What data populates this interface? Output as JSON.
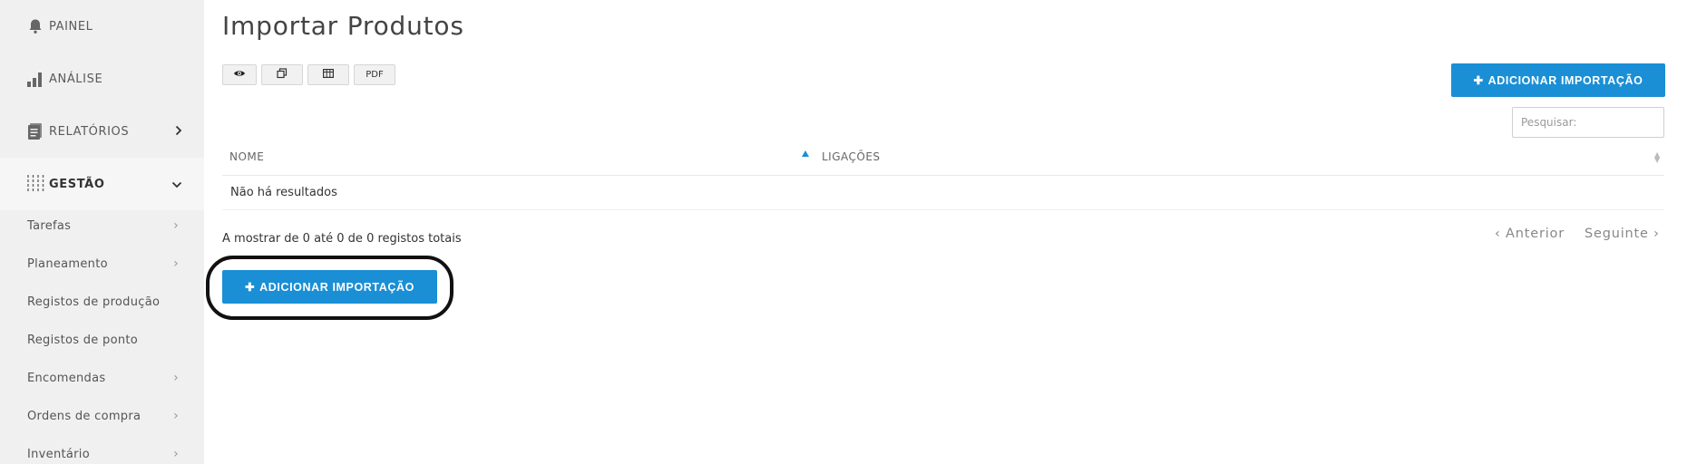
{
  "sidebar": {
    "painel": "PAINEL",
    "analise": "ANÁLISE",
    "relatorios": "RELATÓRIOS",
    "gestao": "GESTÃO",
    "sub_items": [
      {
        "label": "Tarefas"
      },
      {
        "label": "Planeamento"
      },
      {
        "label": "Registos de produção"
      },
      {
        "label": "Registos de ponto"
      },
      {
        "label": "Encomendas"
      },
      {
        "label": "Ordens de compra"
      },
      {
        "label": "Inventário"
      }
    ]
  },
  "main": {
    "title": "Importar Produtos",
    "toolbar": {
      "pdf_label": "PDF"
    },
    "add_import_label": "ADICIONAR IMPORTAÇÃO",
    "search_placeholder": "Pesquisar:",
    "table": {
      "columns": [
        "NOME",
        "LIGAÇÕES"
      ],
      "empty_text": "Não há resultados"
    },
    "info_text": "A mostrar de 0 até 0 de 0 registos totais",
    "pagination": {
      "prev": "Anterior",
      "next": "Seguinte"
    }
  },
  "colors": {
    "accent": "#1a8fd6",
    "sidebar_bg": "#f0f0f0"
  }
}
